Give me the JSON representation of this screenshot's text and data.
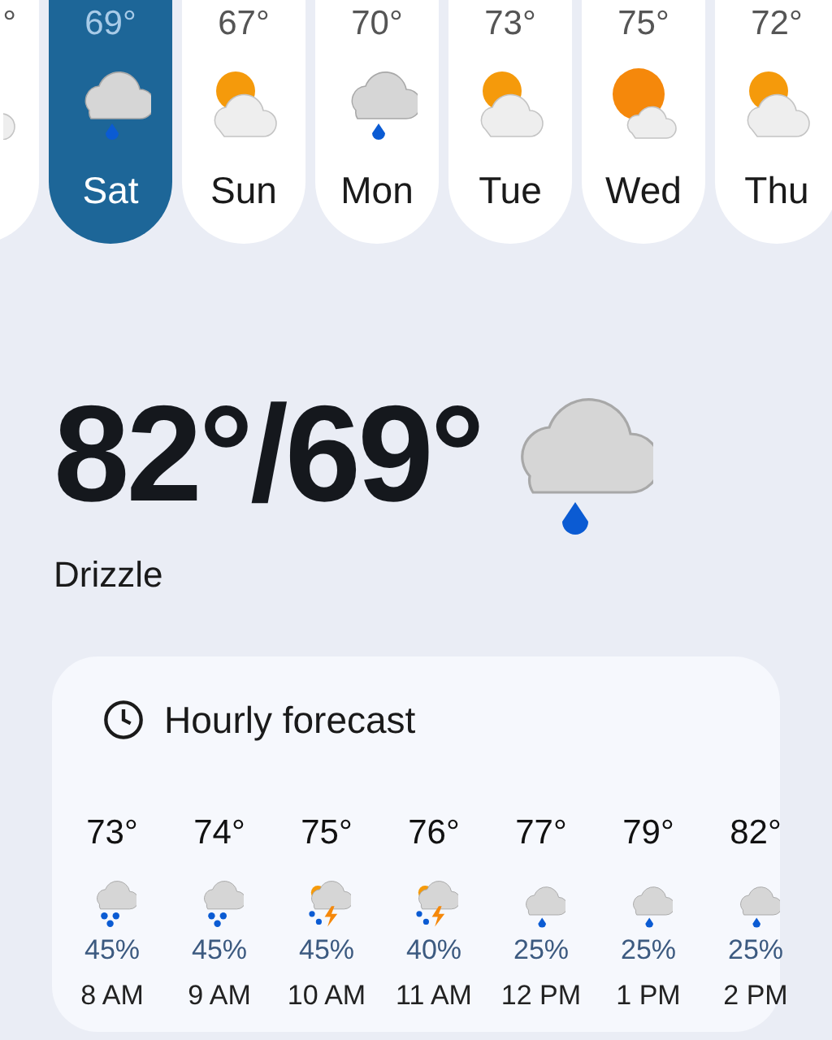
{
  "days": [
    {
      "temp": "°",
      "kind": "partly_sunny",
      "selected": false
    },
    {
      "temp": "69°",
      "day": "Sat",
      "kind": "drizzle",
      "selected": true
    },
    {
      "temp": "67°",
      "day": "Sun",
      "kind": "partly_sunny",
      "selected": false
    },
    {
      "temp": "70°",
      "day": "Mon",
      "kind": "drizzle",
      "selected": false
    },
    {
      "temp": "73°",
      "day": "Tue",
      "kind": "partly_sunny",
      "selected": false
    },
    {
      "temp": "75°",
      "day": "Wed",
      "kind": "mostly_sunny",
      "selected": false
    },
    {
      "temp": "72°",
      "day": "Thu",
      "kind": "partly_sunny",
      "selected": false
    }
  ],
  "current": {
    "temps": "82°/69°",
    "condition": "Drizzle",
    "kind": "drizzle"
  },
  "hourly": {
    "title": "Hourly forecast",
    "hours": [
      {
        "temp": "73°",
        "kind": "showers",
        "precip": "45%",
        "time": "8 AM"
      },
      {
        "temp": "74°",
        "kind": "showers",
        "precip": "45%",
        "time": "9 AM"
      },
      {
        "temp": "75°",
        "kind": "thunder",
        "precip": "45%",
        "time": "10 AM"
      },
      {
        "temp": "76°",
        "kind": "thunder",
        "precip": "40%",
        "time": "11 AM"
      },
      {
        "temp": "77°",
        "kind": "drizzle",
        "precip": "25%",
        "time": "12 PM"
      },
      {
        "temp": "79°",
        "kind": "drizzle",
        "precip": "25%",
        "time": "1 PM"
      },
      {
        "temp": "82°",
        "kind": "drizzle",
        "precip": "25%",
        "time": "2 PM"
      }
    ]
  }
}
